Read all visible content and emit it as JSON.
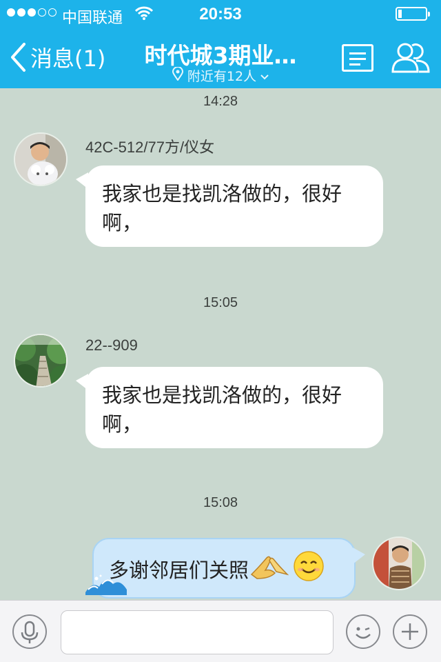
{
  "status_bar": {
    "carrier": "中国联通",
    "time": "20:53"
  },
  "nav": {
    "back_label": "消息(1)",
    "title": "时代城3期业…",
    "subtitle": "附近有12人"
  },
  "chat": {
    "messages": [
      {
        "time": "14:28",
        "sender": "42C-512/77方/仪女",
        "text_line1": "我家也是找凯洛做的，很好",
        "text_line2": "啊，"
      },
      {
        "time": "15:05",
        "sender": "22--909",
        "text_line1": "我家也是找凯洛做的，很好",
        "text_line2": "啊，"
      },
      {
        "time": "15:08",
        "sender": "",
        "text": "多谢邻居们关照"
      }
    ]
  },
  "icons": {
    "back": "chevron-left-icon",
    "location": "location-pin-icon",
    "dropdown": "chevron-down-icon",
    "menu": "menu-lines-icon",
    "group": "group-people-icon",
    "voice": "microphone-icon",
    "emoji": "smiley-icon",
    "add": "plus-icon",
    "handshake": "palms-together-emoji",
    "smile": "smiling-face-emoji"
  },
  "colors": {
    "header": "#1db3ea",
    "chat_bg": "#c9d8cf",
    "outgoing_bubble": "#cfe8fb"
  }
}
